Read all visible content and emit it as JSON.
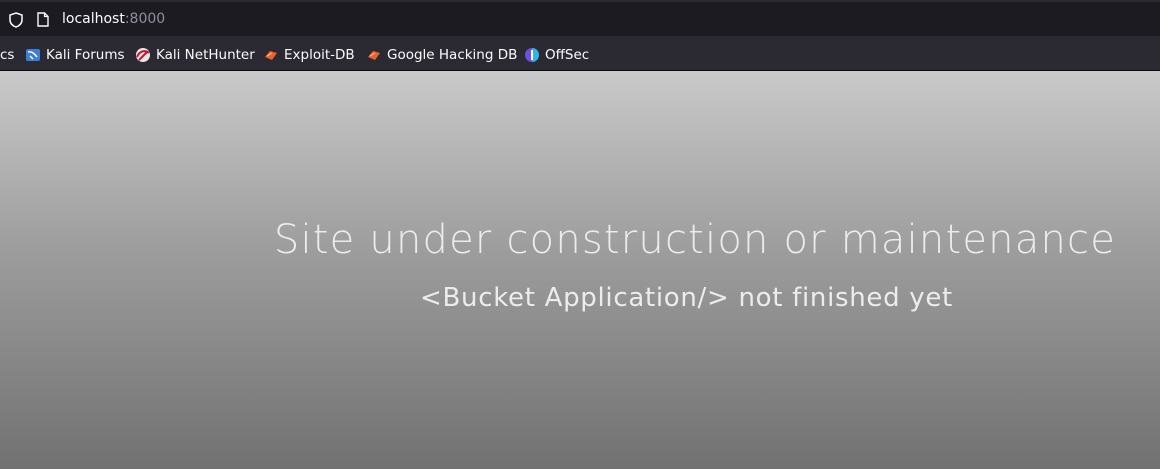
{
  "browser": {
    "url_host": "localhost",
    "url_port": ":8000"
  },
  "bookmarks": [
    {
      "label": "cs",
      "icon": "partial-bookmark"
    },
    {
      "label": "Kali Forums",
      "icon": "kali-forums-icon"
    },
    {
      "label": "Kali NetHunter",
      "icon": "kali-nethunter-icon"
    },
    {
      "label": "Exploit-DB",
      "icon": "exploit-db-icon"
    },
    {
      "label": "Google Hacking DB",
      "icon": "exploit-db-icon"
    },
    {
      "label": "OffSec",
      "icon": "offsec-icon"
    }
  ],
  "page": {
    "headline": "Site under construction or maintenance",
    "subline": "<Bucket Application/> not finished yet"
  }
}
